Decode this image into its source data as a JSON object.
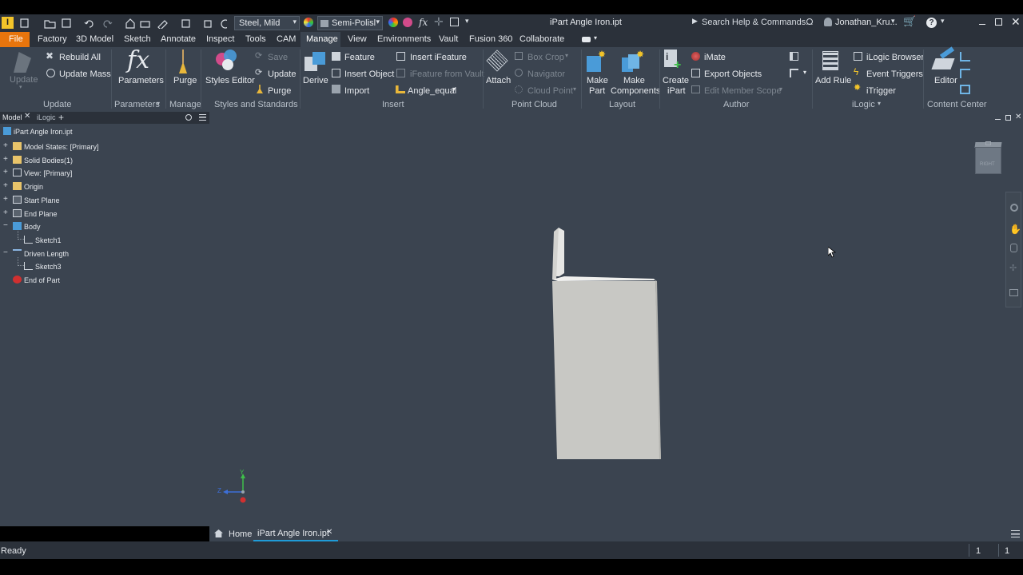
{
  "title_bar": {
    "doc_title": "iPart Angle Iron.ipt",
    "material": "Steel, Mild",
    "appearance": "Semi-Polisl",
    "search_placeholder": "Search Help & Commands...",
    "user": "Jonathan_Kru..."
  },
  "menu": {
    "file": "File",
    "tabs": [
      "Factory",
      "3D Model",
      "Sketch",
      "Annotate",
      "Inspect",
      "Tools",
      "CAM",
      "Manage",
      "View",
      "Environments",
      "Vault",
      "Fusion 360",
      "Collaborate"
    ],
    "active": "Manage"
  },
  "ribbon": {
    "update": {
      "update": "Update",
      "rebuild_all": "Rebuild All",
      "update_mass": "Update Mass",
      "panel": "Update"
    },
    "parameters": {
      "parameters": "Parameters",
      "panel": "Parameters"
    },
    "manage": {
      "purge": "Purge",
      "panel": "Manage"
    },
    "styles": {
      "styles_editor": "Styles Editor",
      "save": "Save",
      "update": "Update",
      "purge": "Purge",
      "panel": "Styles and Standards"
    },
    "insert": {
      "derive": "Derive",
      "feature": "Feature",
      "insert_object": "Insert Object",
      "import": "Import",
      "insert_ifeature": "Insert iFeature",
      "ifeature_from_vault": "iFeature from Vault",
      "angle_equal": "Angle_equal",
      "panel": "Insert"
    },
    "point_cloud": {
      "attach": "Attach",
      "box_crop": "Box Crop",
      "navigator": "Navigator",
      "cloud_point": "Cloud Point",
      "panel": "Point Cloud"
    },
    "layout": {
      "make_part": "Make\nPart",
      "make_part_1": "Make",
      "make_part_2": "Part",
      "make_components_1": "Make",
      "make_components_2": "Components",
      "panel": "Layout"
    },
    "author": {
      "create_ipart_1": "Create",
      "create_ipart_2": "iPart",
      "imate": "iMate",
      "export_objects": "Export Objects",
      "edit_member_scope": "Edit Member Scope",
      "panel": "Author"
    },
    "ilogic": {
      "add_rule": "Add Rule",
      "ilogic_browser": "iLogic Browser",
      "event_triggers": "Event Triggers",
      "itrigger": "iTrigger",
      "panel": "iLogic"
    },
    "content_center": {
      "editor": "Editor",
      "panel": "Content Center"
    }
  },
  "browser": {
    "tabs": [
      "Model",
      "iLogic"
    ],
    "add_tab": "+",
    "root": "iPart Angle Iron.ipt",
    "nodes": [
      {
        "label": "Model States: [Primary]",
        "expander": "+",
        "depth": 0,
        "icon": "folder-icon"
      },
      {
        "label": "Solid Bodies(1)",
        "expander": "+",
        "depth": 0,
        "icon": "folder-icon"
      },
      {
        "label": "View: [Primary]",
        "expander": "+",
        "depth": 0,
        "icon": "view-icon"
      },
      {
        "label": "Origin",
        "expander": "+",
        "depth": 0,
        "icon": "folder-icon"
      },
      {
        "label": "Start Plane",
        "expander": "+",
        "depth": 0,
        "icon": "plane-icon"
      },
      {
        "label": "End Plane",
        "expander": "+",
        "depth": 0,
        "icon": "plane-icon"
      },
      {
        "label": "Body",
        "expander": "−",
        "depth": 0,
        "icon": "body-icon"
      },
      {
        "label": "Sketch1",
        "expander": "",
        "depth": 1,
        "icon": "sketch-icon"
      },
      {
        "label": "Driven Length",
        "expander": "−",
        "depth": 0,
        "icon": "dimension-icon"
      },
      {
        "label": "Sketch3",
        "expander": "",
        "depth": 1,
        "icon": "sketch-icon"
      },
      {
        "label": "End of Part",
        "expander": "",
        "depth": 0,
        "icon": "end-of-part-icon"
      }
    ]
  },
  "viewcube": {
    "face": "RIGHT"
  },
  "triad": {
    "y": "Y",
    "z": "Z"
  },
  "doc_tabs": {
    "home": "Home",
    "active": "iPart Angle Iron.ipt"
  },
  "status": {
    "ready": "Ready",
    "count1": "1",
    "count2": "1"
  },
  "colors": {
    "accent": "#1f9bd7",
    "file_tab": "#e8750d",
    "background": "#3b4450",
    "titlebar": "#2b313a",
    "part": "#c8c8c4"
  }
}
